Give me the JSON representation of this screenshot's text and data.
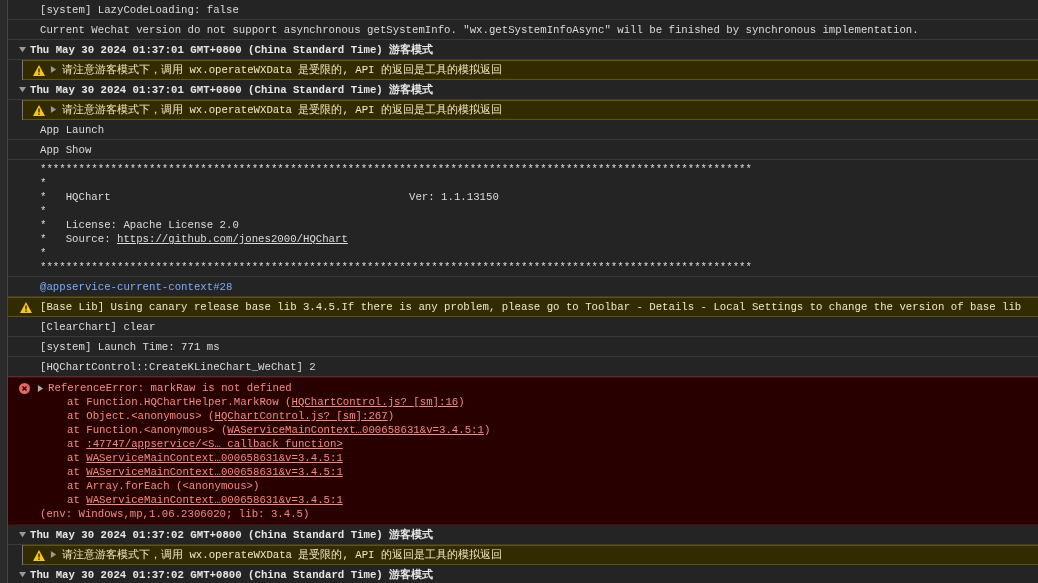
{
  "console": {
    "entries": [
      {
        "kind": "log",
        "text": "[system] LazyCodeLoading: false"
      },
      {
        "kind": "log",
        "text": "Current Wechat version do not support asynchronous getSystemInfo. \"wx.getSystemInfoAsync\" will be finished by synchronous implementation."
      },
      {
        "kind": "group",
        "title": "Thu May 30 2024 01:37:01 GMT+0800 (China Standard Time) 游客模式",
        "expanded": true,
        "children": [
          {
            "kind": "warning",
            "expanded": false,
            "text": "请注意游客模式下，调用 wx.operateWXData 是受限的, API 的返回是工具的模拟返回"
          }
        ]
      },
      {
        "kind": "group",
        "title": "Thu May 30 2024 01:37:01 GMT+0800 (China Standard Time) 游客模式",
        "expanded": true,
        "children": [
          {
            "kind": "warning",
            "expanded": false,
            "text": "请注意游客模式下，调用 wx.operateWXData 是受限的, API 的返回是工具的模拟返回"
          }
        ]
      },
      {
        "kind": "log",
        "text": "App Launch"
      },
      {
        "kind": "log",
        "text": "App Show"
      },
      {
        "kind": "banner",
        "lines": [
          {
            "text": "***************************************************************************************************************"
          },
          {
            "text": "*"
          },
          {
            "text": "*   HQChart",
            "right": "Ver: 1.1.13150"
          },
          {
            "text": "*"
          },
          {
            "text": "*   License: Apache License 2.0"
          },
          {
            "text": "*   Source: ",
            "link": "https://github.com/jones2000/HQChart"
          },
          {
            "text": "*"
          },
          {
            "text": "***************************************************************************************************************"
          }
        ]
      },
      {
        "kind": "link",
        "text": "@appservice-current-context#28"
      },
      {
        "kind": "warning",
        "text": "[Base Lib] Using canary release base lib 3.4.5.If there is any problem, please go to Toolbar - Details - Local Settings to change the version of base lib"
      },
      {
        "kind": "log",
        "text": "[ClearChart] clear"
      },
      {
        "kind": "log",
        "text": "[system] Launch Time: 771 ms"
      },
      {
        "kind": "log",
        "text": "[HQChartControl::CreateKLineChart_WeChat] 2"
      },
      {
        "kind": "error",
        "expanded": false,
        "text": "ReferenceError: markRaw is not defined",
        "stack": [
          {
            "text": "at Function.HQChartHelper.MarkRow (",
            "link": "HQChartControl.js? [sm]:16",
            "end": ")"
          },
          {
            "text": "at Object.<anonymous> (",
            "link": "HQChartControl.js? [sm]:267",
            "end": ")"
          },
          {
            "text": "at Function.<anonymous> (",
            "link": "WAServiceMainContext…000658631&v=3.4.5:1",
            "end": ")"
          },
          {
            "text": "at ",
            "link": ":47747/appservice/<S… callback function>"
          },
          {
            "text": "at ",
            "link": "WAServiceMainContext…000658631&v=3.4.5:1"
          },
          {
            "text": "at ",
            "link": "WAServiceMainContext…000658631&v=3.4.5:1"
          },
          {
            "text": "at Array.forEach (<anonymous>)"
          },
          {
            "text": "at ",
            "link": "WAServiceMainContext…000658631&v=3.4.5:1"
          }
        ],
        "env": "(env: Windows,mp,1.06.2306020; lib: 3.4.5)"
      },
      {
        "kind": "group",
        "title": "Thu May 30 2024 01:37:02 GMT+0800 (China Standard Time) 游客模式",
        "expanded": true,
        "children": [
          {
            "kind": "warning",
            "expanded": false,
            "text": "请注意游客模式下，调用 wx.operateWXData 是受限的, API 的返回是工具的模拟返回"
          }
        ]
      },
      {
        "kind": "group",
        "title": "Thu May 30 2024 01:37:02 GMT+0800 (China Standard Time) 游客模式",
        "expanded": true
      }
    ]
  }
}
